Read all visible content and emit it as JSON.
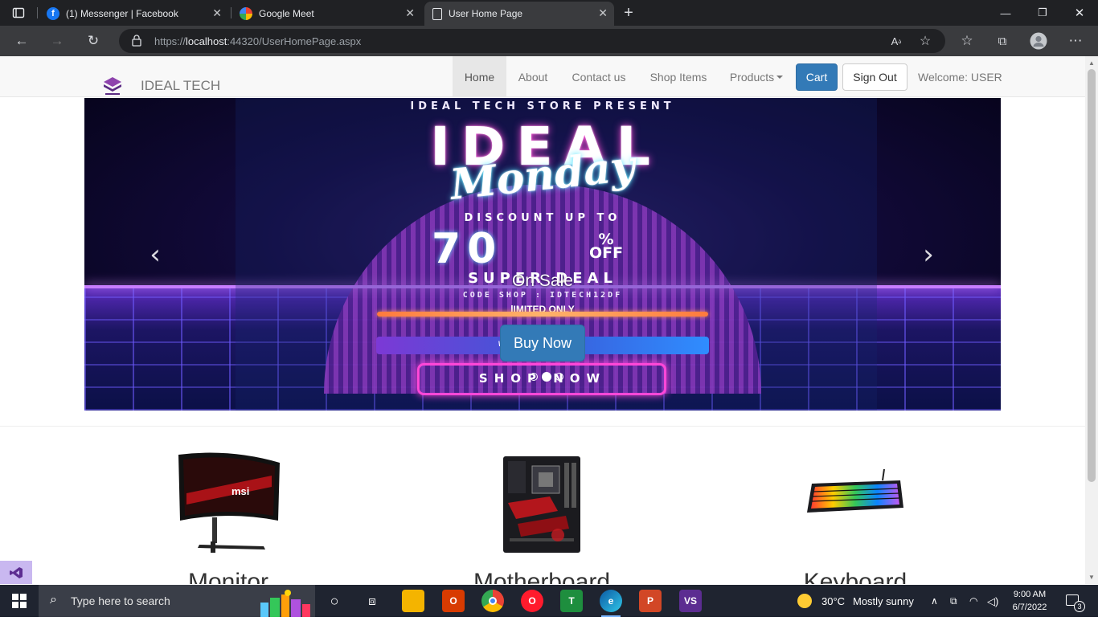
{
  "browser": {
    "tabs": [
      {
        "title": "(1) Messenger | Facebook",
        "icon": "facebook-icon"
      },
      {
        "title": "Google Meet",
        "icon": "google-meet-icon"
      },
      {
        "title": "User Home Page",
        "icon": "page-icon",
        "active": true
      }
    ],
    "url_prefix": "https://",
    "url_host": "localhost",
    "url_rest": ":44320/UserHomePage.aspx"
  },
  "navbar": {
    "brand": "IDEAL TECH",
    "links": [
      "Home",
      "About",
      "Contact us",
      "Shop Items",
      "Products"
    ],
    "cart_label": "Cart",
    "signout_label": "Sign Out",
    "welcome": "Welcome: USER"
  },
  "carousel": {
    "headline_top": "IDEAL TECH STORE PRESENT",
    "headline_main": "IDEAL",
    "headline_script": "Monday",
    "discount_label": "DISCOUNT UP TO",
    "discount_value": "70",
    "discount_pct": "%",
    "discount_off": "OFF",
    "super_deal": "SUPER DEAL",
    "code_text": "CODE SHOP : IDTECH12DF",
    "limited_text": "lIMITED ONLY",
    "website_text": "WWW.ID          OP.COM",
    "shop_now": "SHOP NOW",
    "caption": "On Sale",
    "button": "Buy Now",
    "active_slide": 1,
    "slide_count": 3
  },
  "products": [
    {
      "name": "Monitor",
      "image": "monitor-image"
    },
    {
      "name": "Motherboard",
      "image": "motherboard-image"
    },
    {
      "name": "Keyboard",
      "image": "keyboard-image"
    }
  ],
  "taskbar": {
    "search_placeholder": "Type here to search",
    "weather_temp": "30°C",
    "weather_text": "Mostly sunny",
    "time": "9:00 AM",
    "date": "6/7/2022",
    "notification_count": "3"
  }
}
